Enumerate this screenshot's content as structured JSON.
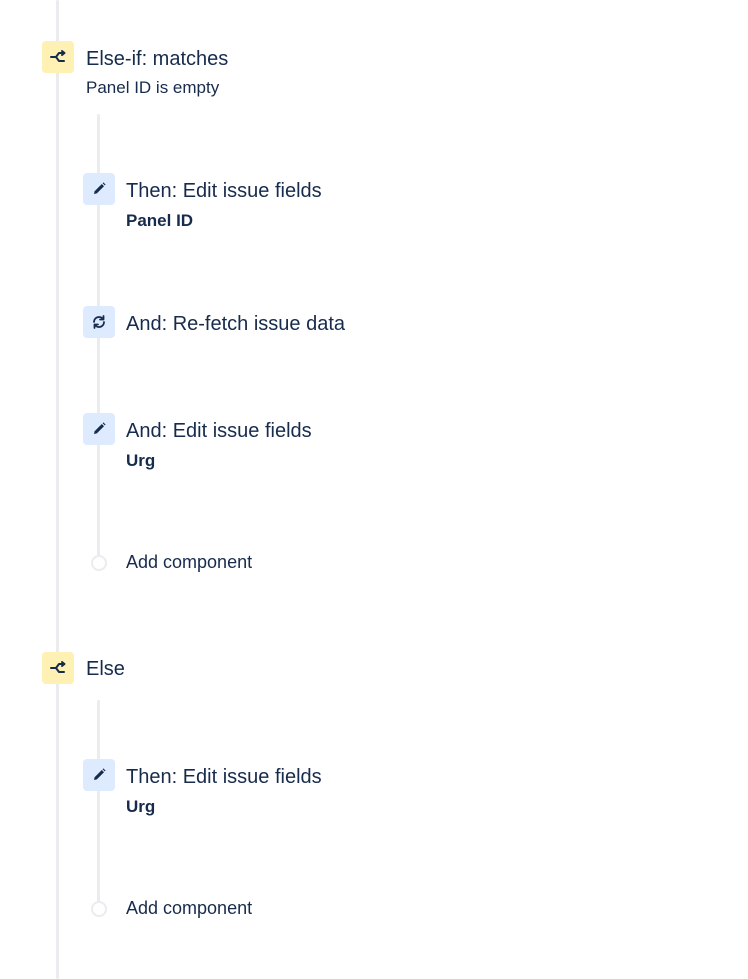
{
  "flow": {
    "else_if_block": {
      "title": "Else-if: matches",
      "condition": "Panel ID is empty",
      "icon": "branch-icon",
      "actions": [
        {
          "title": "Then: Edit issue fields",
          "detail": "Panel ID",
          "icon": "pencil-icon"
        },
        {
          "title": "And: Re-fetch issue data",
          "detail": "",
          "icon": "refresh-icon"
        },
        {
          "title": "And: Edit issue fields",
          "detail": "Urg",
          "icon": "pencil-icon"
        }
      ],
      "add_label": "Add component"
    },
    "else_block": {
      "title": "Else",
      "icon": "branch-icon",
      "actions": [
        {
          "title": "Then: Edit issue fields",
          "detail": "Urg",
          "icon": "pencil-icon"
        }
      ],
      "add_label": "Add component"
    }
  },
  "colors": {
    "branch_bg": "#fff0b3",
    "action_bg": "#deebff",
    "text": "#172b4d",
    "rail": "#ebecf0"
  }
}
